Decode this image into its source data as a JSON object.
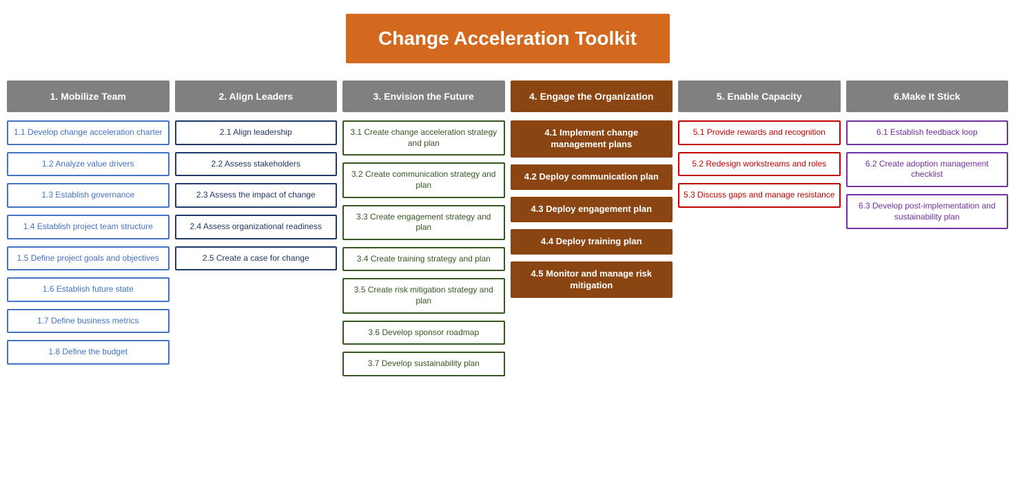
{
  "title": "Change Acceleration Toolkit",
  "columns": [
    {
      "id": "col1",
      "header": "1. Mobilize Team",
      "headerStyle": "gray",
      "cards": [
        {
          "id": "c1_1",
          "text": "1.1 Develop change acceleration charter",
          "style": "blue-border"
        },
        {
          "id": "c1_2",
          "text": "1.2 Analyze value drivers",
          "style": "blue-border"
        },
        {
          "id": "c1_3",
          "text": "1.3 Establish governance",
          "style": "blue-border"
        },
        {
          "id": "c1_4",
          "text": "1.4 Establish project team structure",
          "style": "blue-border"
        },
        {
          "id": "c1_5",
          "text": "1.5 Define project goals and objectives",
          "style": "blue-border"
        },
        {
          "id": "c1_6",
          "text": "1.6 Establish future state",
          "style": "blue-border"
        },
        {
          "id": "c1_7",
          "text": "1.7 Define business metrics",
          "style": "blue-border"
        },
        {
          "id": "c1_8",
          "text": "1.8 Define the budget",
          "style": "blue-border"
        }
      ]
    },
    {
      "id": "col2",
      "header": "2. Align Leaders",
      "headerStyle": "gray",
      "cards": [
        {
          "id": "c2_1",
          "text": "2.1 Align leadership",
          "style": "dark-blue-border"
        },
        {
          "id": "c2_2",
          "text": "2.2 Assess stakeholders",
          "style": "dark-blue-border"
        },
        {
          "id": "c2_3",
          "text": "2.3 Assess the impact of change",
          "style": "dark-blue-border"
        },
        {
          "id": "c2_4",
          "text": "2.4 Assess organizational readiness",
          "style": "dark-blue-border"
        },
        {
          "id": "c2_5",
          "text": "2.5 Create a case for change",
          "style": "dark-blue-border"
        }
      ]
    },
    {
      "id": "col3",
      "header": "3. Envision the Future",
      "headerStyle": "gray",
      "cards": [
        {
          "id": "c3_1",
          "text": "3.1 Create change acceleration strategy and plan",
          "style": "green-border"
        },
        {
          "id": "c3_2",
          "text": "3.2 Create communication strategy and plan",
          "style": "green-border"
        },
        {
          "id": "c3_3",
          "text": "3.3 Create engagement strategy and plan",
          "style": "green-border"
        },
        {
          "id": "c3_4",
          "text": "3.4 Create training strategy and plan",
          "style": "green-border"
        },
        {
          "id": "c3_5",
          "text": "3.5 Create risk mitigation strategy and plan",
          "style": "green-border"
        },
        {
          "id": "c3_6",
          "text": "3.6 Develop sponsor roadmap",
          "style": "green-border"
        },
        {
          "id": "c3_7",
          "text": "3.7 Develop sustainability plan",
          "style": "green-border"
        }
      ]
    },
    {
      "id": "col4",
      "header": "4. Engage the Organization",
      "headerStyle": "dark-orange",
      "cards": [
        {
          "id": "c4_1",
          "text": "4.1 Implement change management plans",
          "style": "dark-orange-border"
        },
        {
          "id": "c4_2",
          "text": "4.2 Deploy communication plan",
          "style": "dark-orange-border"
        },
        {
          "id": "c4_3",
          "text": "4.3 Deploy engagement plan",
          "style": "dark-orange-border"
        },
        {
          "id": "c4_4",
          "text": "4.4 Deploy training plan",
          "style": "dark-orange-border"
        },
        {
          "id": "c4_5",
          "text": "4.5 Monitor and manage risk mitigation",
          "style": "dark-orange-border"
        }
      ]
    },
    {
      "id": "col5",
      "header": "5. Enable Capacity",
      "headerStyle": "gray",
      "cards": [
        {
          "id": "c5_1",
          "text": "5.1 Provide rewards and recognition",
          "style": "red-border"
        },
        {
          "id": "c5_2",
          "text": "5.2 Redesign workstreams and roles",
          "style": "red-border"
        },
        {
          "id": "c5_3",
          "text": "5.3 Discuss gaps and manage resistance",
          "style": "red-border"
        }
      ]
    },
    {
      "id": "col6",
      "header": "6.Make It Stick",
      "headerStyle": "gray",
      "cards": [
        {
          "id": "c6_1",
          "text": "6.1 Establish feedback loop",
          "style": "purple-border"
        },
        {
          "id": "c6_2",
          "text": "6.2 Create adoption management checklist",
          "style": "purple-border"
        },
        {
          "id": "c6_3",
          "text": "6.3 Develop post-implementation and sustainability plan",
          "style": "purple-border"
        }
      ]
    }
  ]
}
